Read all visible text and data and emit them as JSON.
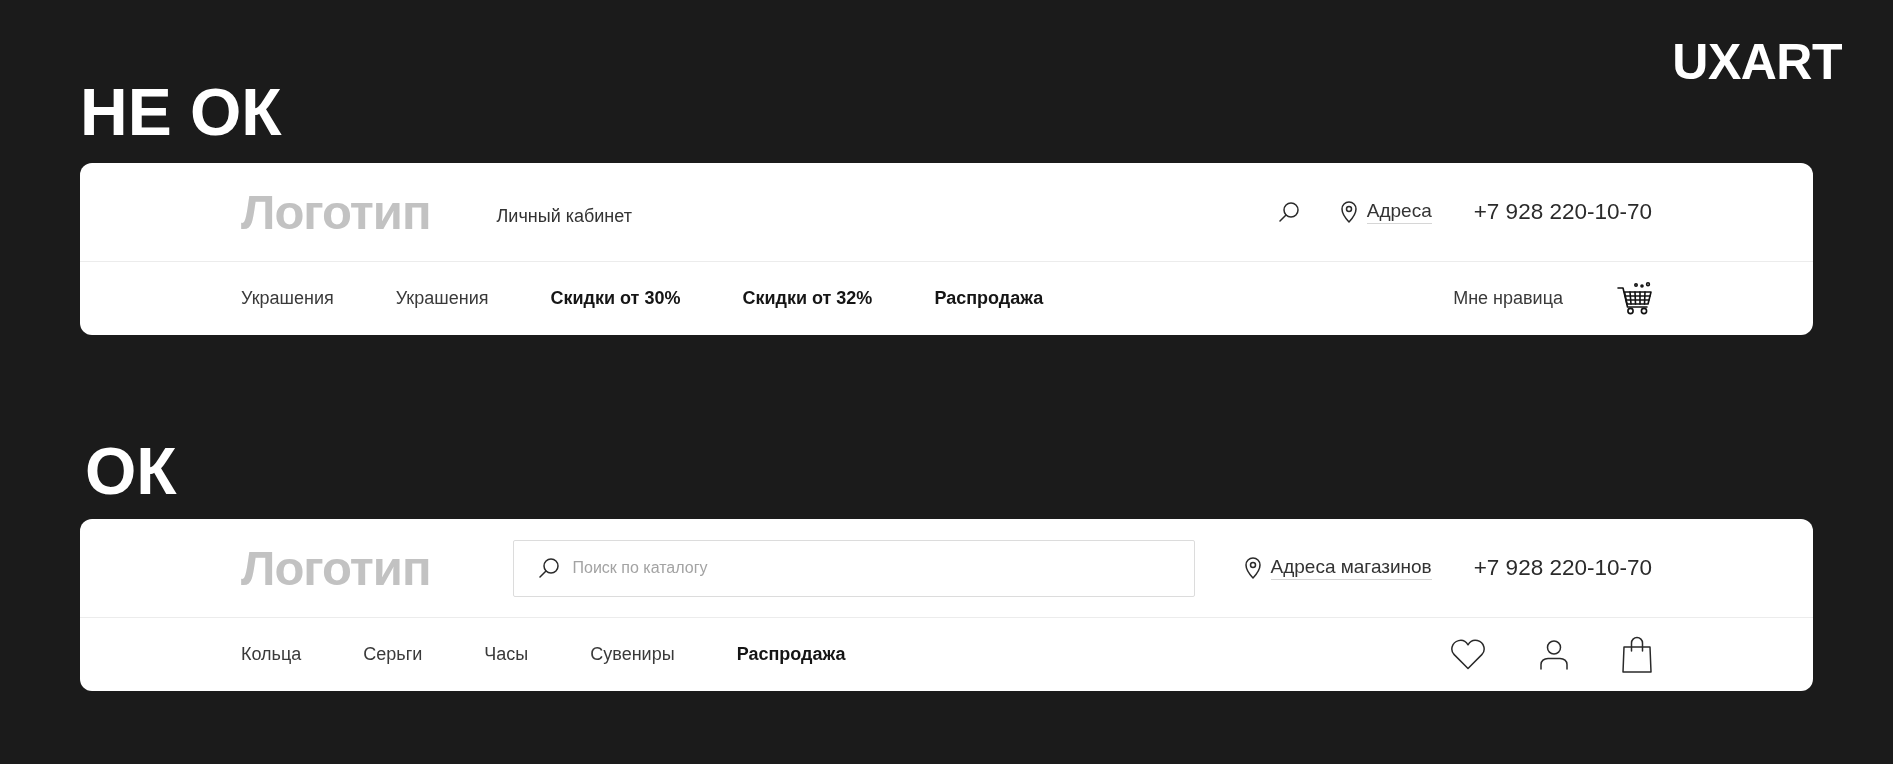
{
  "brand": {
    "text": "UXART"
  },
  "examples": [
    {
      "verdict": "НЕ ОК",
      "top_bar": {
        "logo": "Логотип",
        "left": [
          {
            "kind": "link",
            "text": "Личный кабинет"
          }
        ],
        "right": [
          {
            "kind": "search_icon"
          },
          {
            "kind": "address",
            "text": "Адреса"
          },
          {
            "kind": "phone",
            "text": "+7 928 220-10-70"
          }
        ]
      },
      "nav_bar": {
        "menu": [
          {
            "text": "Украшения",
            "emphasized": false
          },
          {
            "text": "Украшения",
            "emphasized": false
          },
          {
            "text": "Скидки от 30%",
            "emphasized": true
          },
          {
            "text": "Скидки от 32%",
            "emphasized": true
          },
          {
            "text": "Распродажа",
            "emphasized": true
          }
        ],
        "actions": [
          {
            "kind": "link",
            "text": "Мне нравица"
          },
          {
            "kind": "cart"
          }
        ]
      }
    },
    {
      "verdict": "ОК",
      "top_bar": {
        "logo": "Логотип",
        "left": [
          {
            "kind": "search_field",
            "placeholder": "Поиск по каталогу"
          }
        ],
        "right": [
          {
            "kind": "address",
            "text": "Адреса магазинов"
          },
          {
            "kind": "phone",
            "text": "+7 928 220-10-70"
          }
        ]
      },
      "nav_bar": {
        "menu": [
          {
            "text": "Кольца",
            "emphasized": false
          },
          {
            "text": "Серьги",
            "emphasized": false
          },
          {
            "text": "Часы",
            "emphasized": false
          },
          {
            "text": "Сувениры",
            "emphasized": false
          },
          {
            "text": "Распродажа",
            "emphasized": true
          }
        ],
        "actions": [
          {
            "kind": "favorites"
          },
          {
            "kind": "account"
          },
          {
            "kind": "bag"
          }
        ]
      }
    }
  ]
}
